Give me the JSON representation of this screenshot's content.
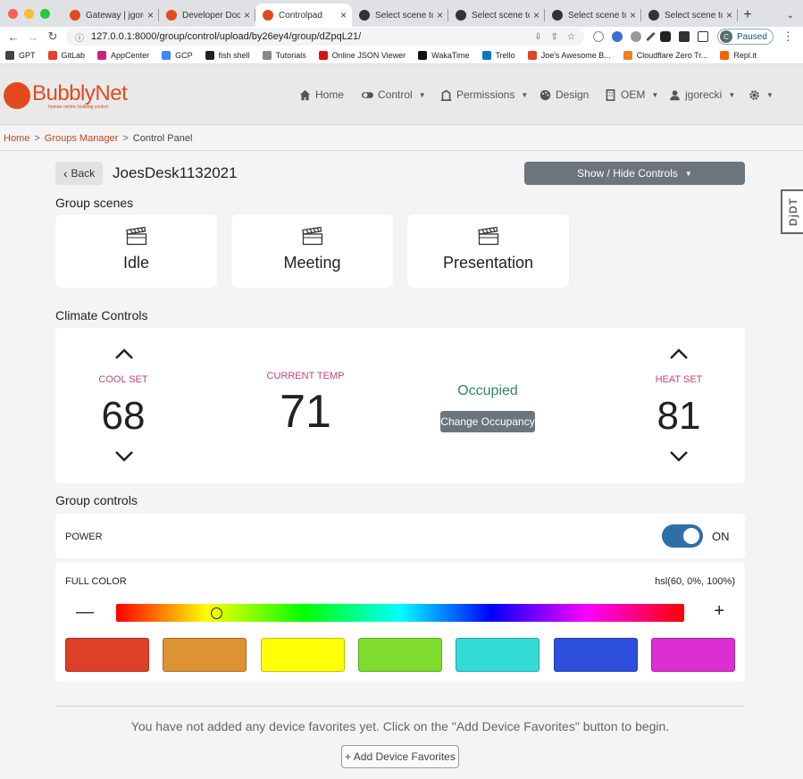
{
  "browser": {
    "tabs": [
      {
        "title": "Gateway | jgorec",
        "color": "#e24a1e",
        "active": false
      },
      {
        "title": "Developer Docs",
        "color": "#e24a1e",
        "active": false
      },
      {
        "title": "Controlpad",
        "color": "#e24a1e",
        "active": true
      },
      {
        "title": "Select scene to",
        "color": "#333333",
        "active": false
      },
      {
        "title": "Select scene to",
        "color": "#333333",
        "active": false
      },
      {
        "title": "Select scene to",
        "color": "#333333",
        "active": false
      },
      {
        "title": "Select scene to",
        "color": "#333333",
        "active": false
      }
    ],
    "url": "127.0.0.1:8000/group/control/upload/by26ey4/group/dZpqL21/",
    "profile_initial": "C",
    "profile_status": "Paused",
    "bookmarks": [
      {
        "label": "GPT",
        "color": "#444444"
      },
      {
        "label": "GitLab",
        "color": "#e24329"
      },
      {
        "label": "AppCenter",
        "color": "#cc2277"
      },
      {
        "label": "GCP",
        "color": "#4285f4"
      },
      {
        "label": "fish shell",
        "color": "#222222"
      },
      {
        "label": "Tutorials",
        "color": "#888888"
      },
      {
        "label": "Online JSON Viewer",
        "color": "#d11"
      },
      {
        "label": "WakaTime",
        "color": "#111111"
      },
      {
        "label": "Trello",
        "color": "#0079bf"
      },
      {
        "label": "Joe's Awesome B...",
        "color": "#e24329"
      },
      {
        "label": "Cloudflare Zero Tr...",
        "color": "#f38020"
      },
      {
        "label": "Repl.it",
        "color": "#f26207"
      }
    ]
  },
  "brand": {
    "name": "BubblyNet",
    "tagline": "human-centric building control",
    "color": "#e24a1e"
  },
  "nav": {
    "home": "Home",
    "control": "Control",
    "permissions": "Permissions",
    "design": "Design",
    "oem": "OEM",
    "user": "jgorecki"
  },
  "breadcrumb": {
    "home": "Home",
    "groups": "Groups Manager",
    "current": "Control Panel"
  },
  "page": {
    "back_label": "Back",
    "title": "JoesDesk1132021",
    "show_hide_label": "Show / Hide Controls"
  },
  "scenes": {
    "heading": "Group scenes",
    "items": [
      "Idle",
      "Meeting",
      "Presentation"
    ]
  },
  "climate": {
    "heading": "Climate Controls",
    "cool_label": "COOL SET",
    "cool_value": "68",
    "current_label": "CURRENT TEMP",
    "current_value": "71",
    "occupancy": "Occupied",
    "occupancy_button": "Change Occupancy",
    "heat_label": "HEAT SET",
    "heat_value": "81"
  },
  "group_controls": {
    "heading": "Group controls",
    "power_label": "POWER",
    "power_state": "ON",
    "full_color_label": "FULL COLOR",
    "color_value": "hsl(60, 0%, 100%)",
    "hue_position": 0.177,
    "swatches": [
      "#dd4027",
      "#dd9233",
      "#ffff05",
      "#80dd2e",
      "#32dbd5",
      "#2e4fdd",
      "#dd2ed1"
    ]
  },
  "favorites": {
    "empty_text": "You have not added any device favorites yet. Click on the \"Add Device Favorites\" button to begin.",
    "add_button": "+ Add Device Favorites"
  },
  "debug_toolbar": {
    "label": "DjDT"
  }
}
